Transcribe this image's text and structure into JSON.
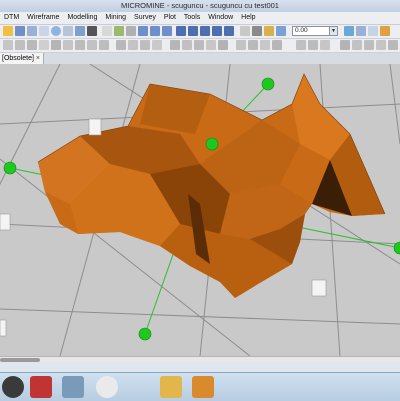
{
  "window": {
    "title": "MICROMINE - scuguncu - scuguncu cu test001"
  },
  "menu": [
    "DTM",
    "Wireframe",
    "Modelling",
    "Mining",
    "Survey",
    "Plot",
    "Tools",
    "Window",
    "Help"
  ],
  "toolbar": {
    "zoom_value": "0.00"
  },
  "tabs": [
    {
      "label": "[Obsolete]"
    }
  ],
  "colors": {
    "surface": "#c86a16",
    "surface_dark": "#8a4408",
    "handle": "#1ec81e",
    "grid": "#8d8d8d",
    "background": "#c9c9c9"
  },
  "taskbar_icons": [
    "start-orb-icon",
    "file-archive-icon",
    "calculator-icon",
    "paint-icon",
    "folder-cube-icon",
    "media-player-icon"
  ]
}
